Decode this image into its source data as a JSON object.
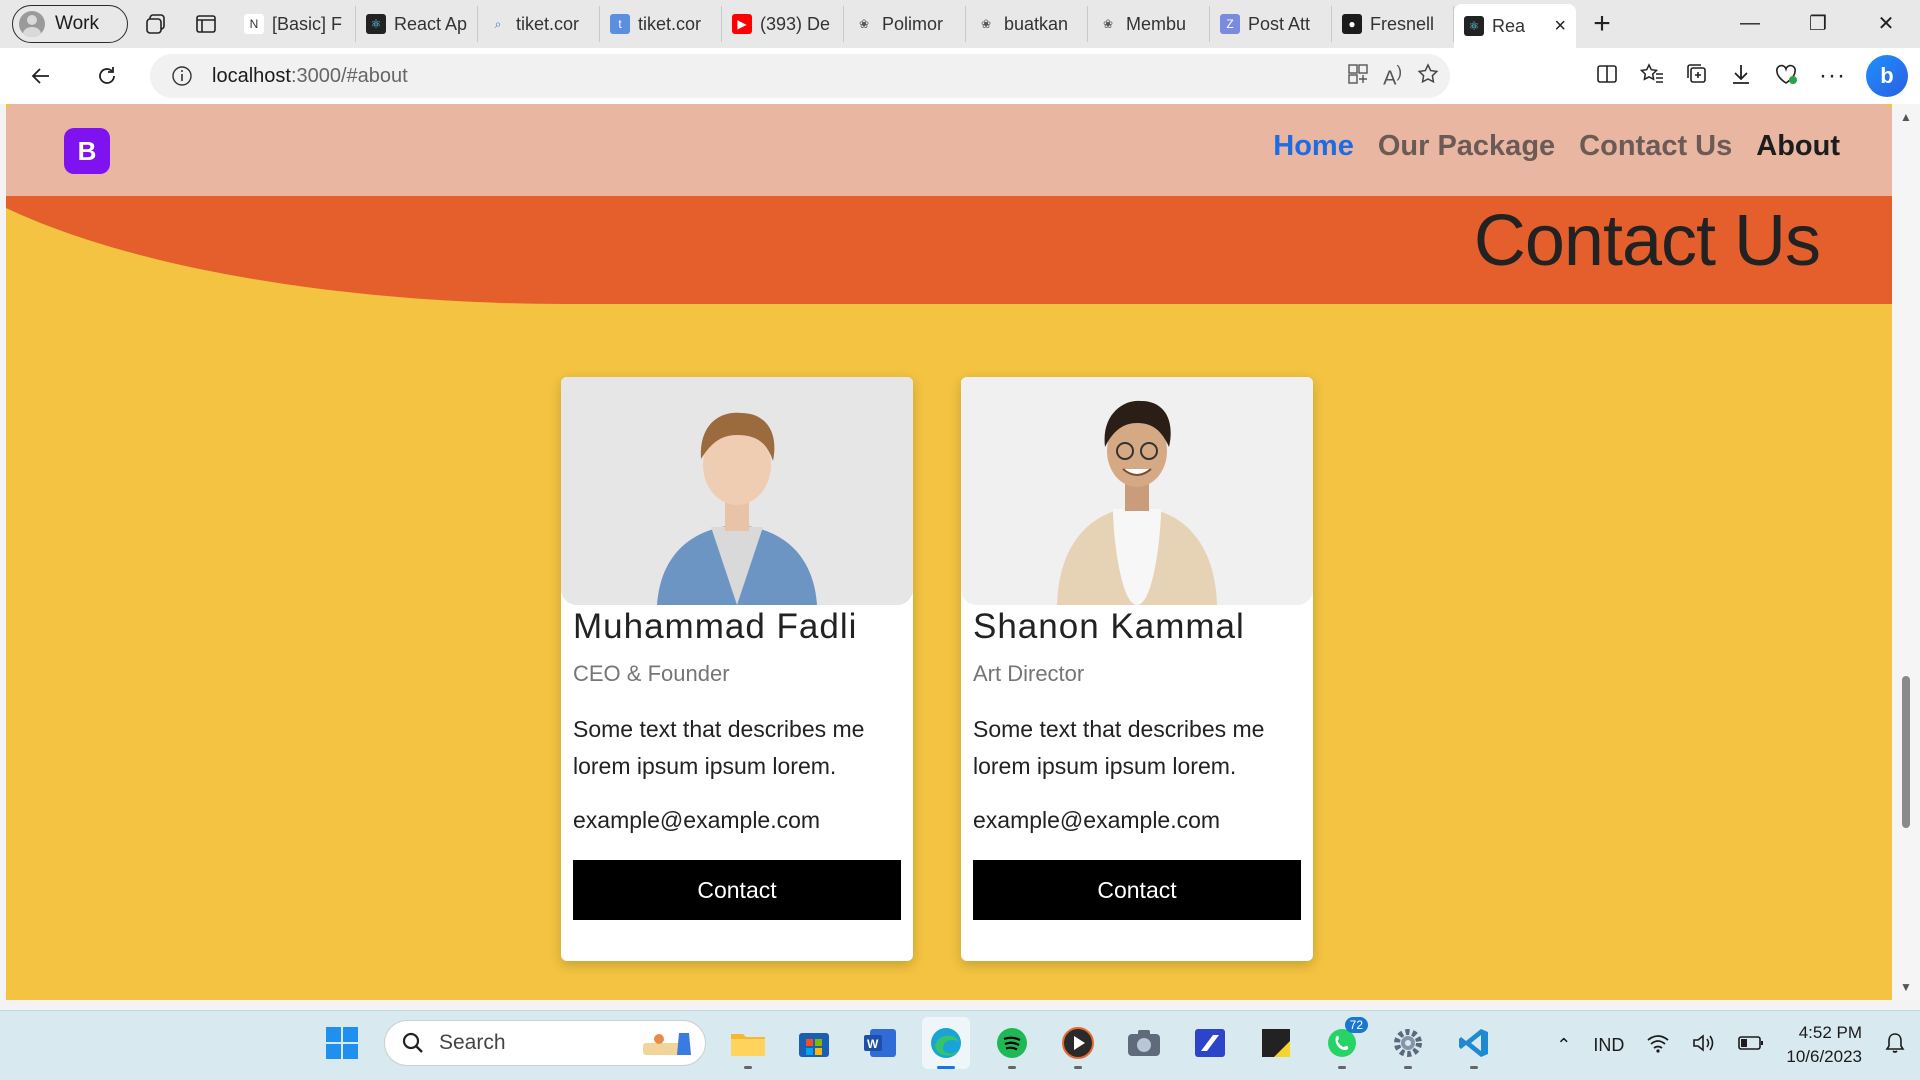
{
  "browser": {
    "profile_label": "Work",
    "tabs": [
      {
        "label": "[Basic] F",
        "icon": "notion-icon"
      },
      {
        "label": "React Ap",
        "icon": "react-icon"
      },
      {
        "label": "tiket.cor",
        "icon": "search-icon"
      },
      {
        "label": "tiket.cor",
        "icon": "tiket-icon"
      },
      {
        "label": "(393) De",
        "icon": "youtube-icon"
      },
      {
        "label": "Polimor",
        "icon": "chatgpt-icon"
      },
      {
        "label": "buatkan",
        "icon": "chatgpt-icon"
      },
      {
        "label": "Membu",
        "icon": "chatgpt-icon"
      },
      {
        "label": "Post Att",
        "icon": "z-icon"
      },
      {
        "label": "Fresnell",
        "icon": "github-icon"
      },
      {
        "label": "Rea",
        "icon": "react-icon",
        "active": true
      }
    ],
    "url_host": "localhost",
    "url_rest": ":3000/#about"
  },
  "page": {
    "brand_letter": "B",
    "nav": {
      "home": "Home",
      "package": "Our Package",
      "contact": "Contact Us",
      "about": "About"
    },
    "heading": "Contact Us",
    "cards": [
      {
        "name": "Muhammad Fadli",
        "role": "CEO & Founder",
        "description": "Some text that describes me lorem ipsum ipsum lorem.",
        "email": "example@example.com",
        "button": "Contact"
      },
      {
        "name": "Shanon Kammal",
        "role": "Art Director",
        "description": "Some text that describes me lorem ipsum ipsum lorem.",
        "email": "example@example.com",
        "button": "Contact"
      }
    ]
  },
  "colors": {
    "page_bg": "#f3c341",
    "navbar_bg": "#e8b6a1",
    "wave": "#e45f2c",
    "brand": "#7f12f0",
    "nav_active": "#1e6be6"
  },
  "taskbar": {
    "search_label": "Search",
    "whatsapp_badge": "72",
    "language": "IND",
    "time": "4:52 PM",
    "date": "10/6/2023"
  }
}
